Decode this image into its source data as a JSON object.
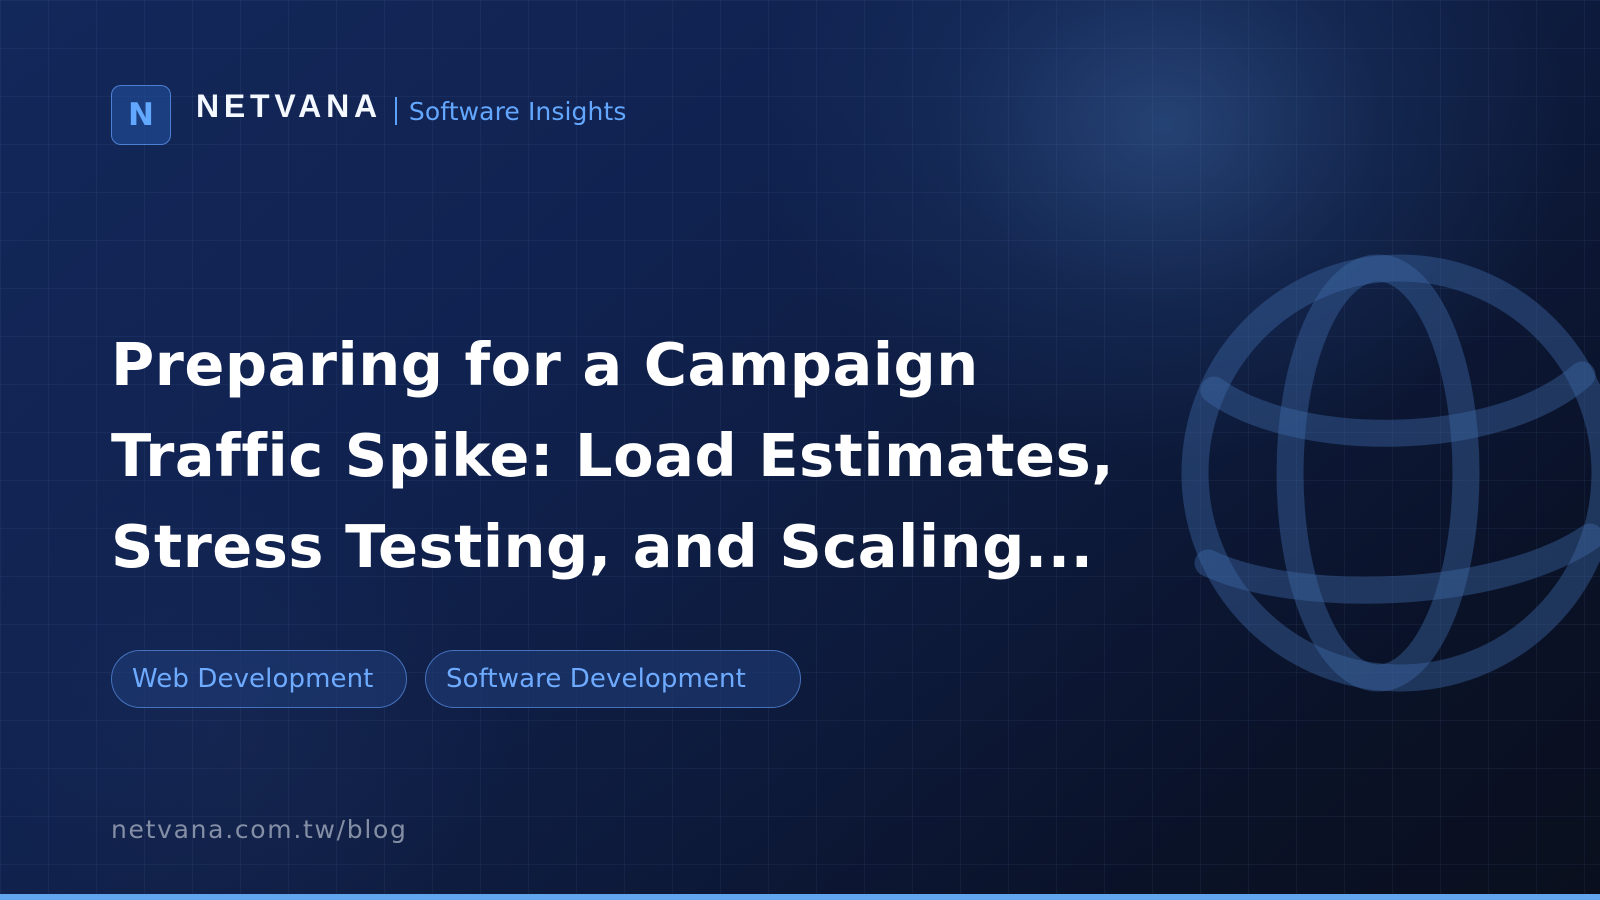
{
  "brand": {
    "logo_letter": "N",
    "name": "NETVANA",
    "tagline": "Software Insights"
  },
  "article": {
    "title_lines": [
      "Preparing for a Campaign",
      "Traffic Spike: Load Estimates,",
      "Stress Testing, and Scaling..."
    ],
    "tags": [
      "Web Development",
      "Software Development"
    ],
    "url": "netvana.com.tw/blog"
  },
  "icons": {
    "logo": "logo-badge",
    "decorative_globe": "globe-icon"
  },
  "colors": {
    "accent_blue": "#62a8ff",
    "tag_text": "#6eabff",
    "headline": "#ffffff",
    "url_text": "#8e98ad",
    "bottom_bar": "#62a5ef"
  }
}
